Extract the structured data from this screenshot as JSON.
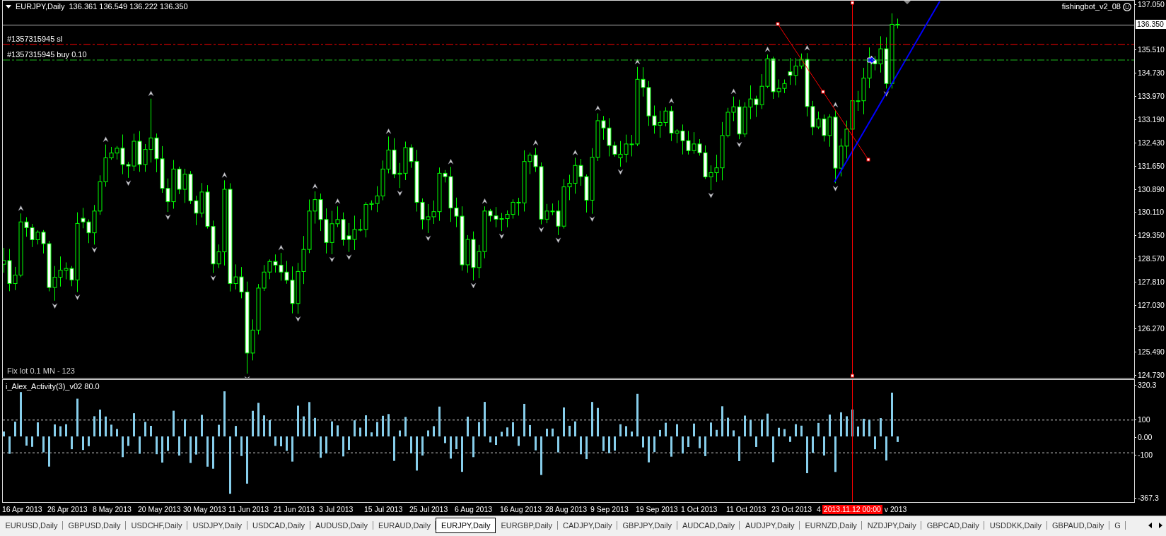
{
  "chart": {
    "title": {
      "symbol": "EURJPY,Daily",
      "ohlc": "136.361 136.549 136.222 136.350"
    },
    "expert": "fishingbot_v2_08",
    "order_lines": [
      {
        "kind": "stop_loss",
        "label": "#1357315945 sl"
      },
      {
        "kind": "order",
        "label": "#1357315945 buy 0.10"
      }
    ],
    "comment": "Fix lot 0.1 MN - 123",
    "price_axis": {
      "labels": [
        "137.050",
        "135.510",
        "134.730",
        "133.970",
        "133.190",
        "132.430",
        "131.650",
        "130.890",
        "130.110",
        "129.350",
        "128.570",
        "127.810",
        "127.030",
        "126.270",
        "125.490",
        "124.730"
      ],
      "current_price": "136.350"
    }
  },
  "indicator": {
    "title": "i_Alex_Activity(3)_v02 80.0",
    "axis_labels": [
      "320.3",
      "100",
      "0.00",
      "-100",
      "-367.3"
    ]
  },
  "time_axis": {
    "labels": [
      "16 Apr 2013",
      "26 Apr 2013",
      "8 May 2013",
      "20 May 2013",
      "30 May 2013",
      "11 Jun 2013",
      "21 Jun 2013",
      "3 Jul 2013",
      "15 Jul 2013",
      "25 Jul 2013",
      "6 Aug 2013",
      "16 Aug 2013",
      "28 Aug 2013",
      "9 Sep 2013",
      "19 Sep 2013",
      "1 Oct 2013",
      "11 Oct 2013",
      "23 Oct 2013"
    ],
    "cursor": {
      "left_fragment": "4",
      "label": "2013.11.12 00:00",
      "right_fragment": "v 2013"
    }
  },
  "tabs": [
    {
      "label": "EURUSD,Daily",
      "selected": false
    },
    {
      "label": "GBPUSD,Daily",
      "selected": false
    },
    {
      "label": "USDCHF,Daily",
      "selected": false
    },
    {
      "label": "USDJPY,Daily",
      "selected": false
    },
    {
      "label": "USDCAD,Daily",
      "selected": false
    },
    {
      "label": "AUDUSD,Daily",
      "selected": false
    },
    {
      "label": "EURAUD,Daily",
      "selected": false
    },
    {
      "label": "EURJPY,Daily",
      "selected": true
    },
    {
      "label": "EURGBP,Daily",
      "selected": false
    },
    {
      "label": "CADJPY,Daily",
      "selected": false
    },
    {
      "label": "GBPJPY,Daily",
      "selected": false
    },
    {
      "label": "AUDCAD,Daily",
      "selected": false
    },
    {
      "label": "AUDJPY,Daily",
      "selected": false
    },
    {
      "label": "EURNZD,Daily",
      "selected": false
    },
    {
      "label": "NZDJPY,Daily",
      "selected": false
    },
    {
      "label": "GBPCAD,Daily",
      "selected": false
    },
    {
      "label": "USDDKK,Daily",
      "selected": false
    },
    {
      "label": "GBPAUD,Daily",
      "selected": false
    },
    {
      "label": "G",
      "selected": false
    }
  ]
}
